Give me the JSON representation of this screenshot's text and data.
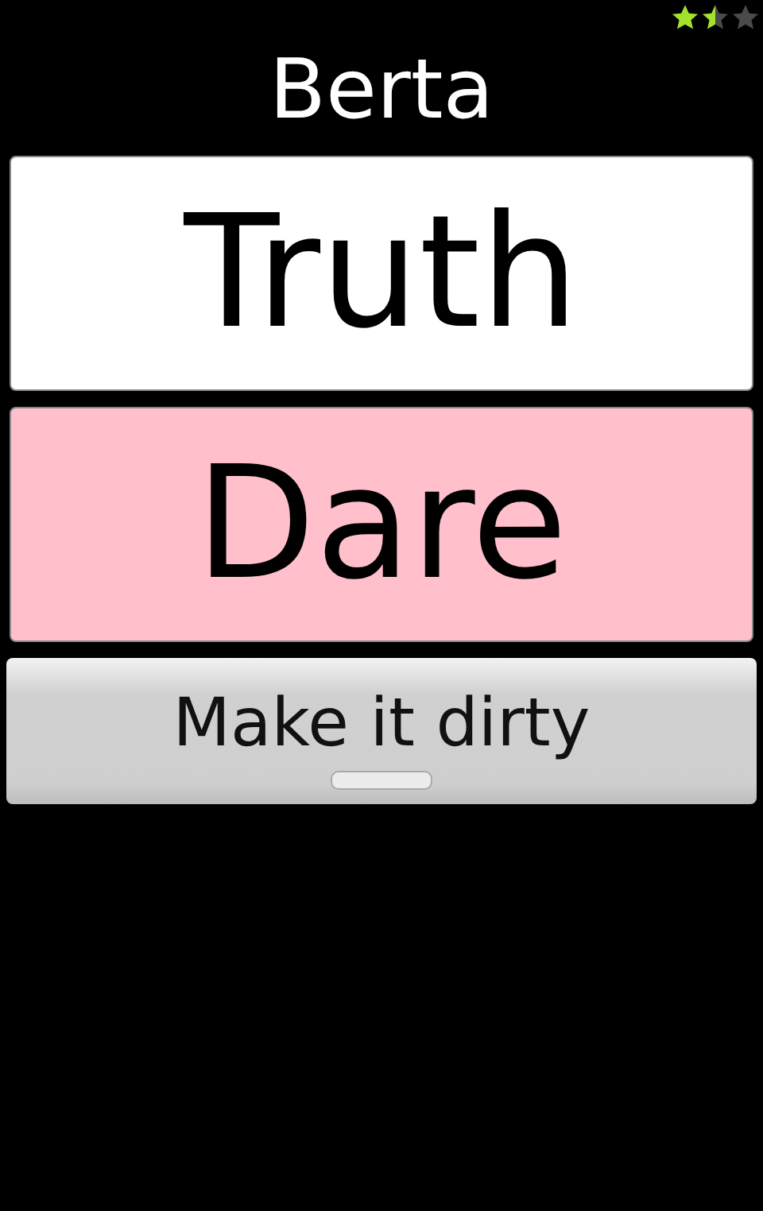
{
  "rating": {
    "stars": 1.5
  },
  "title": "Berta",
  "choices": [
    {
      "label": "Truth",
      "color": "#ffffff"
    },
    {
      "label": "Dare",
      "color": "#ffc0cb"
    }
  ],
  "toggle": {
    "label": "Make it dirty",
    "on": false
  }
}
